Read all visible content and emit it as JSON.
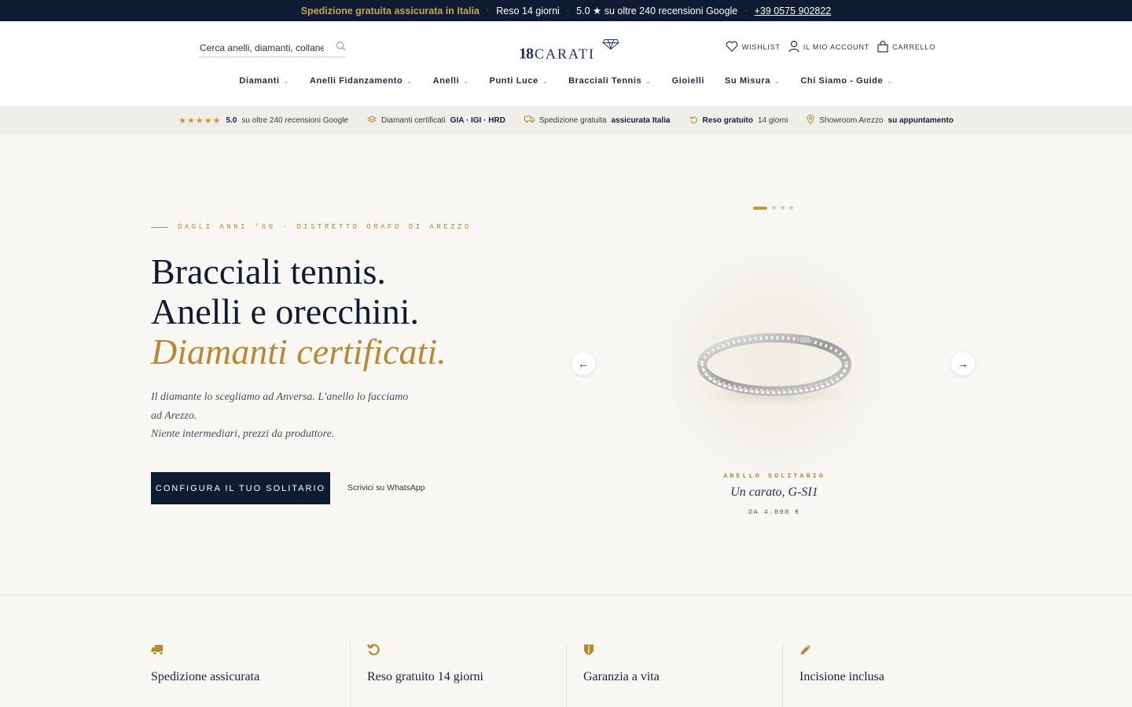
{
  "topbar": {
    "shipping": "Spedizione gratuita assicurata in Italia",
    "returns": "Reso 14 giorni",
    "rating": "5.0 ★ su oltre 240 recensioni Google",
    "phone": "+39 0575 902822",
    "separator": "·"
  },
  "header": {
    "search_placeholder": "Cerca anelli, diamanti, collane..",
    "logo_number": "18",
    "logo_word": "CARATI",
    "wishlist": "WISHLIST",
    "account": "IL MIO ACCOUNT",
    "cart": "CARRELLO"
  },
  "nav": [
    {
      "label": "Diamanti",
      "dropdown": true
    },
    {
      "label": "Anelli Fidanzamento",
      "dropdown": true
    },
    {
      "label": "Anelli",
      "dropdown": true
    },
    {
      "label": "Punti Luce",
      "dropdown": true
    },
    {
      "label": "Bracciali Tennis",
      "dropdown": true
    },
    {
      "label": "Gioielli",
      "dropdown": false
    },
    {
      "label": "Su Misura",
      "dropdown": true
    },
    {
      "label": "Chi Siamo - Guide",
      "dropdown": true
    }
  ],
  "trust": {
    "stars": "★★★★★",
    "rating_bold": "5.0",
    "rating_rest": "su oltre 240 recensioni Google",
    "cert_prefix": "Diamanti certificati",
    "cert_bold": "GIA · IGI · HRD",
    "ship_prefix": "Spedizione gratuita",
    "ship_bold": "assicurata Italia",
    "return_bold": "Reso gratuito",
    "return_rest": "14 giorni",
    "showroom_prefix": "Showroom Arezzo",
    "showroom_bold": "su appuntamento"
  },
  "hero": {
    "eyebrow": "DAGLI ANNI '60 · DISTRETTO ORAFO DI AREZZO",
    "line1": "Bracciali tennis.",
    "line2": "Anelli e orecchini.",
    "line3": "Diamanti certificati.",
    "lead1": "Il diamante lo scegliamo ad Anversa. L'anello lo facciamo ad Arezzo.",
    "lead2": "Niente intermediari, prezzi da produttore.",
    "cta": "CONFIGURA IL TUO SOLITARIO",
    "whatsapp": "Scrivici su WhatsApp"
  },
  "carousel": {
    "slides": 4,
    "active": 1,
    "kicker": "ANELLO SOLITARIO",
    "title": "Un carato, G-SI1",
    "price": "DA 4.890 €",
    "prev": "←",
    "next": "→"
  },
  "features": [
    {
      "title": "Spedizione assicurata",
      "icon": "truck-icon"
    },
    {
      "title": "Reso gratuito 14 giorni",
      "icon": "return-icon"
    },
    {
      "title": "Garanzia a vita",
      "icon": "shield-icon"
    },
    {
      "title": "Incisione inclusa",
      "icon": "pencil-icon"
    }
  ],
  "colors": {
    "navy": "#0f1b33",
    "gold": "#b8892f",
    "background": "#f8f7f4"
  }
}
